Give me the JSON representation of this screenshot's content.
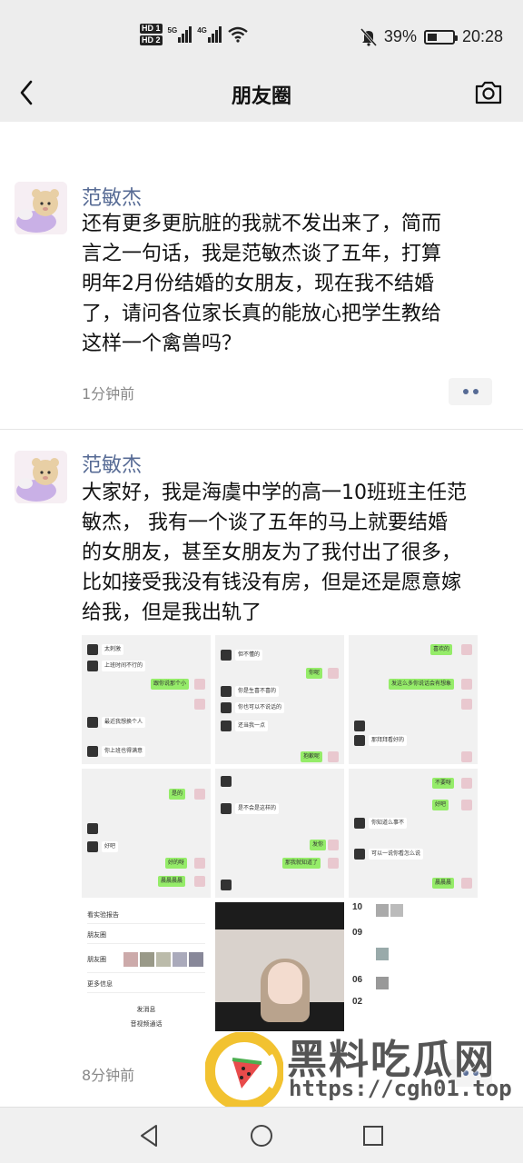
{
  "status_bar": {
    "hd1": "HD 1",
    "hd2": "HD 2",
    "net1": "5G",
    "net2": "4G",
    "battery_percent": "39%",
    "battery_level": 0.39,
    "time": "20:28"
  },
  "nav": {
    "title": "朋友圈",
    "icons": [
      "back-arrow-icon",
      "camera-icon"
    ]
  },
  "posts": [
    {
      "author": "范敏杰",
      "lines": [
        "还有更多更肮脏的我就不发出来了，简而",
        "言之一句话，我是范敏杰谈了五年，打算",
        "明年2月份结婚的女朋友，现在我不结婚",
        "了，请问各位家长真的能放心把学生教给",
        "这样一个禽兽吗？"
      ],
      "time": "1分钟前"
    },
    {
      "author": "范敏杰",
      "lines": [
        "大家好，我是海虞中学的高一10班班主任范",
        "敏杰， 我有一个谈了五年的马上就要结婚",
        "的女朋友，甚至女朋友为了我付出了很多，",
        "比如接受我没有钱没有房，但是还是愿意嫁",
        "给我，但是我出轨了"
      ],
      "time": "8分钟前",
      "images": [
        {
          "bubbles": [
            "太刺激",
            "上班时间不行的",
            "跟你说那个小",
            "最近我想换个人",
            "你上班也得满意"
          ]
        },
        {
          "bubbles": [
            "但不懂的",
            "你呢",
            "你是生喜不喜的",
            "你也可以不说话的",
            "还当我一点",
            "抱歉呢"
          ]
        },
        {
          "bubbles": [
            "喜欢的",
            "发这么多你说话会有想象",
            "那拜拜看好的"
          ]
        },
        {
          "bubbles": [
            "是的",
            "好吧"
          ]
        },
        {
          "bubbles": [
            "是不会是这样的",
            "发你",
            "那我就知道了"
          ]
        },
        {
          "bubbles": [
            "好吧",
            "你知道么事不",
            "可以一说你看怎么说"
          ]
        },
        {
          "bubbles": [
            "看实验报告",
            "朋友圈",
            "朋友圈",
            "更多信息",
            "发消息",
            "音视频通话"
          ]
        },
        {
          "bubbles": []
        },
        {
          "bubbles": [
            "10",
            "09",
            "06",
            "02"
          ]
        }
      ]
    }
  ],
  "watermark": {
    "title": "黑料吃瓜网",
    "url": "https://cgh01.top"
  }
}
